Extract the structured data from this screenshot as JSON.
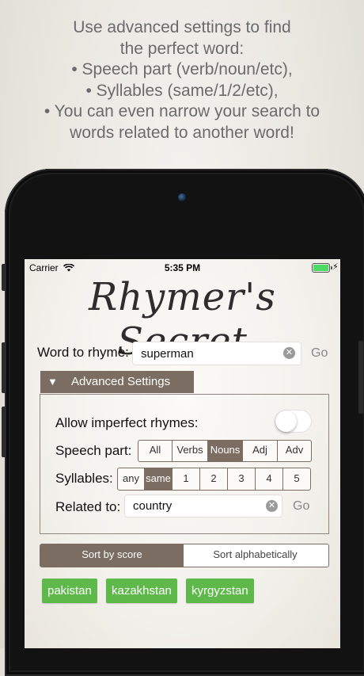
{
  "promo": {
    "lines": [
      "Use advanced settings to find",
      "the perfect word:",
      "• Speech part (verb/noun/etc),",
      "• Syllables (same/1/2/etc),",
      "• You can even narrow your search to",
      "words related to another word!"
    ]
  },
  "status_bar": {
    "carrier": "Carrier",
    "time": "5:35 PM",
    "battery_color": "#4cd964"
  },
  "app": {
    "title": "Rhymer's Secret",
    "word_label": "Word to rhyme:",
    "word_value": "superman",
    "go_label": "Go",
    "advanced": {
      "label": "Advanced Settings",
      "imperfect_label": "Allow imperfect rhymes:",
      "imperfect_on": false,
      "speech_label": "Speech part:",
      "speech_options": [
        "All",
        "Verbs",
        "Nouns",
        "Adj",
        "Adv"
      ],
      "speech_selected": "Nouns",
      "syllables_label": "Syllables:",
      "syllable_options": [
        "any",
        "same",
        "1",
        "2",
        "3",
        "4",
        "5"
      ],
      "syllables_selected": "same",
      "related_label": "Related to:",
      "related_value": "country",
      "related_go": "Go"
    },
    "sort": {
      "options": [
        "Sort by score",
        "Sort alphabetically"
      ],
      "selected": "Sort by score"
    },
    "results": [
      "pakistan",
      "kazakhstan",
      "kyrgyzstan"
    ]
  },
  "colors": {
    "accent": "#7b6d61",
    "result_chip": "#5fb94a"
  }
}
